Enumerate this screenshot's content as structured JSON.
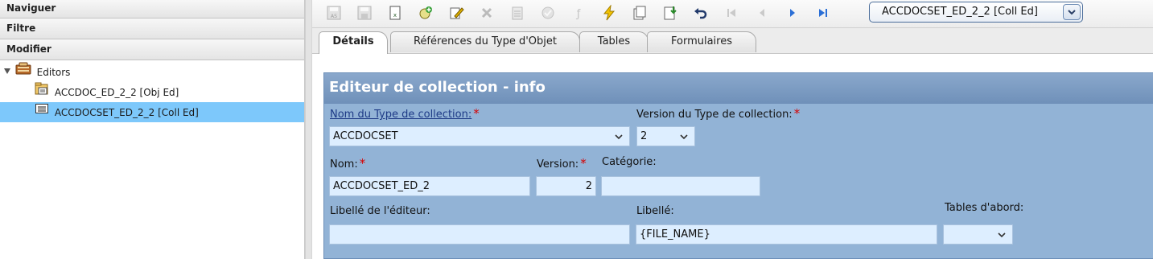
{
  "left_pane": {
    "sections": [
      {
        "label": "Naviguer"
      },
      {
        "label": "Filtre"
      },
      {
        "label": "Modifier"
      }
    ],
    "tree": {
      "root": {
        "label": "Editors",
        "icon": "folder-editors-icon"
      },
      "children": [
        {
          "label": "ACCDOC_ED_2_2 [Obj Ed]",
          "icon": "object-editor-icon",
          "selected": false
        },
        {
          "label": "ACCDOCSET_ED_2_2 [Coll Ed]",
          "icon": "collection-editor-icon",
          "selected": true
        }
      ]
    }
  },
  "toolbar": {
    "icons": [
      "save-as-icon",
      "save-icon",
      "export-icon",
      "add-icon",
      "edit-icon",
      "delete-icon",
      "properties-icon",
      "validate-icon",
      "generate-icon",
      "lightning-icon",
      "copy-icon",
      "download-icon",
      "undo-icon",
      "first-icon",
      "previous-icon",
      "next-icon",
      "last-icon"
    ],
    "document_select": {
      "value": "ACCDOCSET_ED_2_2 [Coll Ed]"
    }
  },
  "tabs": [
    {
      "label": "Détails",
      "active": true
    },
    {
      "label": "Références du Type d'Objet",
      "active": false
    },
    {
      "label": "Tables",
      "active": false
    },
    {
      "label": "Formulaires",
      "active": false
    }
  ],
  "form": {
    "title": "Editeur de collection - info",
    "required_marker": "*",
    "collection_type": {
      "label": "Nom du Type de collection:",
      "value": "ACCDOCSET"
    },
    "collection_version": {
      "label": "Version du Type de collection:",
      "value": "2"
    },
    "name": {
      "label": "Nom:",
      "value": "ACCDOCSET_ED_2"
    },
    "version": {
      "label": "Version:",
      "value": "2"
    },
    "category": {
      "label": "Catégorie:",
      "value": ""
    },
    "editor_label": {
      "label": "Libellé de l'éditeur:",
      "value": ""
    },
    "libelle": {
      "label": "Libellé:",
      "value": "{FILE_NAME}"
    },
    "tables_abord": {
      "label": "Tables d'abord:",
      "value": ""
    }
  },
  "colors": {
    "selection": "#7dc8fb",
    "panel_bg": "#92b3d6",
    "panel_title": "#6f90b9",
    "input_bg": "#ddeeff",
    "required": "#d60000",
    "link": "#1d3a86"
  }
}
